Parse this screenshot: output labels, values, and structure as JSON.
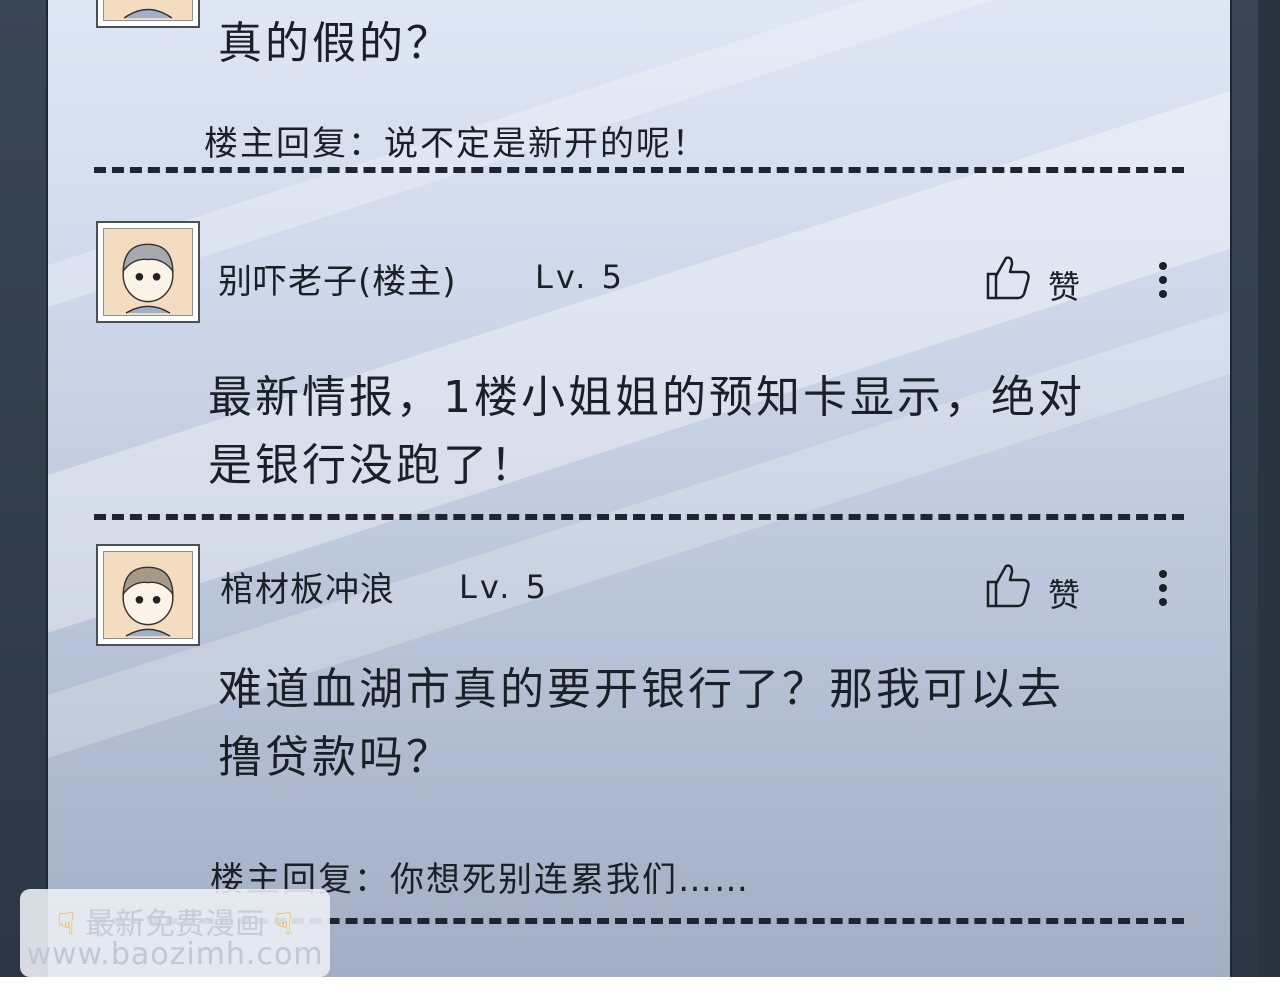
{
  "posts": [
    {
      "comment": "真的假的？",
      "reply": "楼主回复：说不定是新开的呢！"
    },
    {
      "username": "别吓老子(楼主)",
      "level": "Lv. 5",
      "like_label": "赞",
      "comment_line1": "最新情报，1楼小姐姐的预知卡显示，绝对",
      "comment_line2": "是银行没跑了！"
    },
    {
      "username": "棺材板冲浪",
      "level": "Lv. 5",
      "like_label": "赞",
      "comment_line1": "难道血湖市真的要开银行了？那我可以去",
      "comment_line2": "撸贷款吗？",
      "reply": "楼主回复：你想死别连累我们……"
    }
  ],
  "watermark": {
    "line1": "最新免费漫画",
    "line2": "www.baozimh.com",
    "icon": "pointing-down-hand-icon"
  },
  "colors": {
    "panel_top": "#dfe6f4",
    "panel_bottom": "#a3adc3",
    "avatar_bg": "#f4dcc0",
    "text": "#1b1f27"
  }
}
